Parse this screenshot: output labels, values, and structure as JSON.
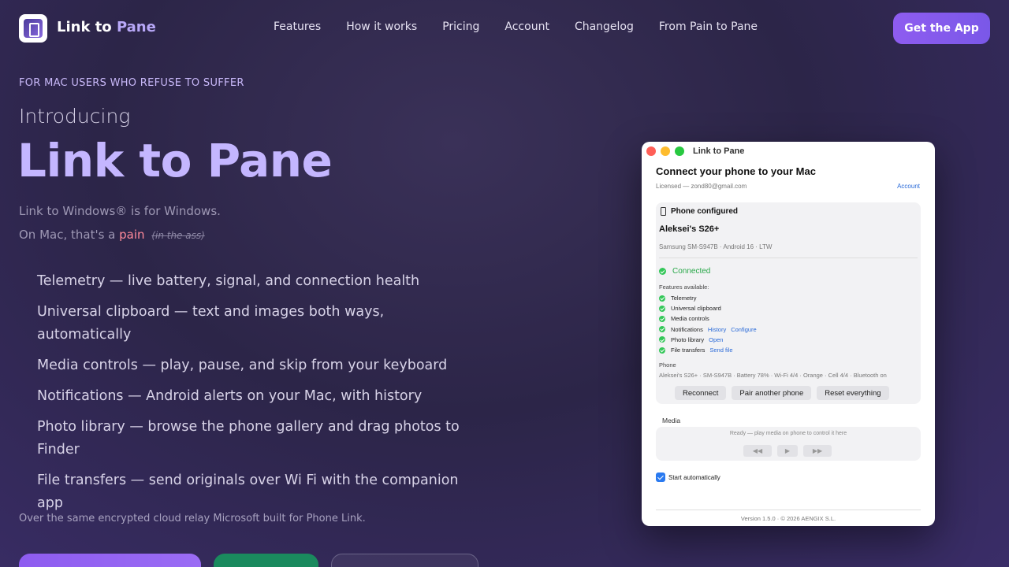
{
  "header": {
    "brand_main": "Link to",
    "brand_accent": "Pane",
    "nav": [
      "Features",
      "How it works",
      "Pricing",
      "Account",
      "Changelog",
      "From Pain to Pane"
    ],
    "cta": "Get the App"
  },
  "hero": {
    "eyebrow": "FOR MAC USERS WHO REFUSE TO SUFFER",
    "introducing": "Introducing",
    "title": "Link to Pane",
    "tagline_1": "Link to Windows® is for Windows.",
    "tagline_2_prefix": "On Mac, that's a",
    "tagline_2_pain": "pain",
    "tagline_2_strike": "(in the ass)",
    "features": [
      "Telemetry — live battery, signal, and connection health",
      "Universal clipboard — text and images both ways, automatically",
      "Media controls — play, pause, and skip from your keyboard",
      "Notifications — Android alerts on your Mac, with history",
      "Photo library — browse the phone gallery and drag photos to Finder",
      "File transfers — send originals over Wi  Fi with the companion app"
    ],
    "footnote": "Over the same encrypted cloud relay Microsoft built for Phone Link."
  },
  "app_window": {
    "title": "Link to Pane",
    "heading": "Connect your phone to your Mac",
    "license": "Licensed — zond80@gmail.com",
    "account_link": "Account",
    "phone_configured": "Phone configured",
    "device_name": "Aleksei's S26+",
    "device_model": "Samsung SM-S947B · Android 16 · LTW",
    "status": "Connected",
    "features_label": "Features available:",
    "features": [
      {
        "name": "Telemetry",
        "links": []
      },
      {
        "name": "Universal clipboard",
        "links": []
      },
      {
        "name": "Media controls",
        "links": []
      },
      {
        "name": "Notifications",
        "links": [
          "History",
          "Configure"
        ]
      },
      {
        "name": "Photo library",
        "links": [
          "Open"
        ]
      },
      {
        "name": "File transfers",
        "links": [
          "Send file"
        ]
      }
    ],
    "phone_label": "Phone",
    "phone_status_line": "Aleksei's S26+ · SM-S947B · Battery 78% · Wi-Fi 4/4 · Orange · Cell 4/4 · Bluetooth on",
    "buttons": [
      "Reconnect",
      "Pair another phone",
      "Reset everything"
    ],
    "media_label": "Media",
    "media_status": "Ready — play media on phone to control it here",
    "media_controls": [
      "◀◀",
      "▶",
      "▶▶"
    ],
    "start_auto": "Start automatically",
    "version": "Version 1.5.0 · © 2026 AENGIX S.L."
  }
}
